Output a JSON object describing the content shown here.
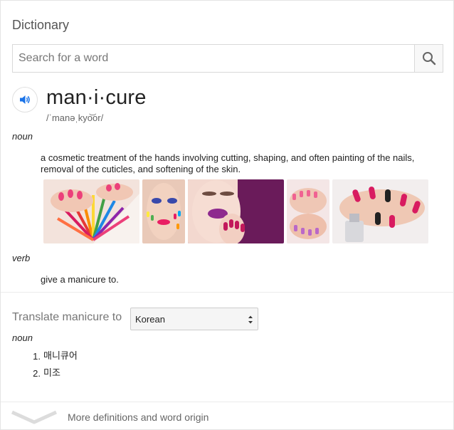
{
  "header": {
    "title": "Dictionary"
  },
  "search": {
    "placeholder": "Search for a word",
    "value": ""
  },
  "entry": {
    "headword": "man·i·cure",
    "phonetic": "/ˈmanəˌkyo͝or/",
    "senses": [
      {
        "pos": "noun",
        "definition": "a cosmetic treatment of the hands involving cutting, shaping, and often painting of the nails, removal of the cuticles, and softening of the skin."
      },
      {
        "pos": "verb",
        "definition": "give a manicure to."
      }
    ]
  },
  "translate": {
    "label": "Translate manicure to",
    "language": "Korean",
    "pos": "noun",
    "items": [
      {
        "num": "1.",
        "text": "매니큐어"
      },
      {
        "num": "2.",
        "text": "미조"
      }
    ]
  },
  "footer": {
    "more_label": "More definitions and word origin"
  },
  "colors": {
    "accent": "#1a73e8",
    "text": "#222222",
    "muted": "#777777",
    "border": "#d9d9d9"
  },
  "icons": {
    "search": "search-icon",
    "speaker": "speaker-icon",
    "expand": "chevron-down-icon"
  }
}
